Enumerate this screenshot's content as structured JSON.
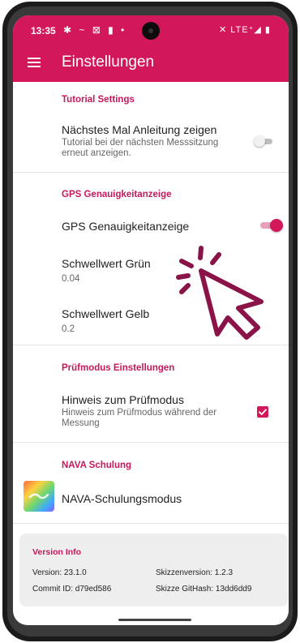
{
  "status_bar": {
    "time": "13:35",
    "notification_icons": "✱ ~ ⊠ ▮ •",
    "right_icons": "✕ LTE⁺◢ ▮"
  },
  "app_bar": {
    "title": "Einstellungen",
    "menu_icon": "hamburger-icon"
  },
  "sections": {
    "tutorial": {
      "header": "Tutorial Settings",
      "item_title": "Nächstes Mal Anleitung zeigen",
      "item_sub": "Tutorial bei der nächsten Messsitzung erneut anzeigen.",
      "toggle_on": false
    },
    "gps": {
      "header": "GPS Genauigkeitanzeige",
      "toggle_title": "GPS Genauigkeitanzeige",
      "toggle_on": true,
      "green_title": "Schwellwert Grün",
      "green_value": "0.04",
      "yellow_title": "Schwellwert Gelb",
      "yellow_value": "0.2"
    },
    "pruef": {
      "header": "Prüfmodus Einstellungen",
      "item_title": "Hinweis zum Prüfmodus",
      "item_sub": "Hinweis zum Prüfmodus während der Messung",
      "checked": true
    },
    "nava": {
      "header": "NAVA Schulung",
      "item_title": "NAVA-Schulungsmodus"
    }
  },
  "version_info": {
    "title": "Version Info",
    "version": "Version: 23.1.0",
    "commit": "Commit ID: d79ed586",
    "skizzen_version": "Skizzenversion: 1.2.3",
    "skizze_hash": "Skizze GitHash: 13dd6dd9"
  },
  "colors": {
    "accent": "#d2185a",
    "cursor": "#8a1447"
  }
}
